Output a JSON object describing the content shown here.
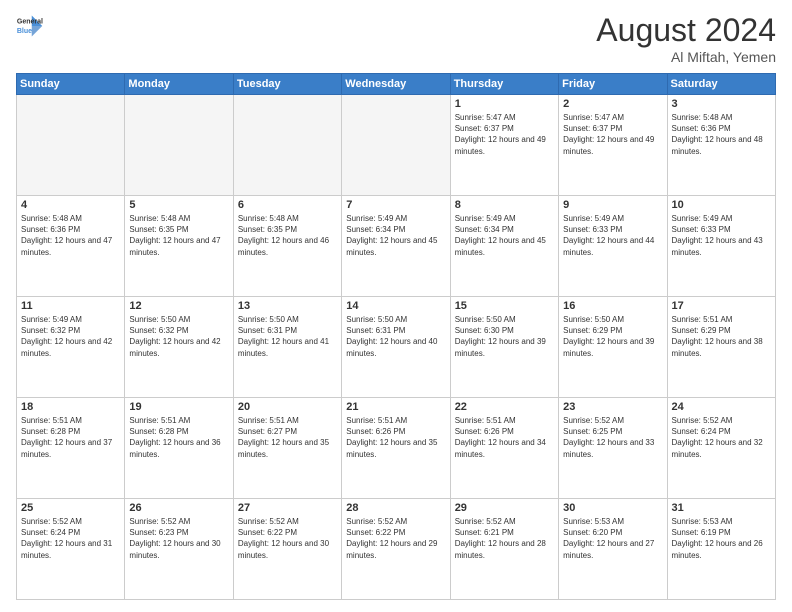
{
  "header": {
    "logo_line1": "General",
    "logo_line2": "Blue",
    "month_year": "August 2024",
    "location": "Al Miftah, Yemen"
  },
  "days_of_week": [
    "Sunday",
    "Monday",
    "Tuesday",
    "Wednesday",
    "Thursday",
    "Friday",
    "Saturday"
  ],
  "weeks": [
    [
      {
        "day": "",
        "empty": true
      },
      {
        "day": "",
        "empty": true
      },
      {
        "day": "",
        "empty": true
      },
      {
        "day": "",
        "empty": true
      },
      {
        "day": "1",
        "sunrise": "5:47 AM",
        "sunset": "6:37 PM",
        "daylight": "12 hours and 49 minutes."
      },
      {
        "day": "2",
        "sunrise": "5:47 AM",
        "sunset": "6:37 PM",
        "daylight": "12 hours and 49 minutes."
      },
      {
        "day": "3",
        "sunrise": "5:48 AM",
        "sunset": "6:36 PM",
        "daylight": "12 hours and 48 minutes."
      }
    ],
    [
      {
        "day": "4",
        "sunrise": "5:48 AM",
        "sunset": "6:36 PM",
        "daylight": "12 hours and 47 minutes."
      },
      {
        "day": "5",
        "sunrise": "5:48 AM",
        "sunset": "6:35 PM",
        "daylight": "12 hours and 47 minutes."
      },
      {
        "day": "6",
        "sunrise": "5:48 AM",
        "sunset": "6:35 PM",
        "daylight": "12 hours and 46 minutes."
      },
      {
        "day": "7",
        "sunrise": "5:49 AM",
        "sunset": "6:34 PM",
        "daylight": "12 hours and 45 minutes."
      },
      {
        "day": "8",
        "sunrise": "5:49 AM",
        "sunset": "6:34 PM",
        "daylight": "12 hours and 45 minutes."
      },
      {
        "day": "9",
        "sunrise": "5:49 AM",
        "sunset": "6:33 PM",
        "daylight": "12 hours and 44 minutes."
      },
      {
        "day": "10",
        "sunrise": "5:49 AM",
        "sunset": "6:33 PM",
        "daylight": "12 hours and 43 minutes."
      }
    ],
    [
      {
        "day": "11",
        "sunrise": "5:49 AM",
        "sunset": "6:32 PM",
        "daylight": "12 hours and 42 minutes."
      },
      {
        "day": "12",
        "sunrise": "5:50 AM",
        "sunset": "6:32 PM",
        "daylight": "12 hours and 42 minutes."
      },
      {
        "day": "13",
        "sunrise": "5:50 AM",
        "sunset": "6:31 PM",
        "daylight": "12 hours and 41 minutes."
      },
      {
        "day": "14",
        "sunrise": "5:50 AM",
        "sunset": "6:31 PM",
        "daylight": "12 hours and 40 minutes."
      },
      {
        "day": "15",
        "sunrise": "5:50 AM",
        "sunset": "6:30 PM",
        "daylight": "12 hours and 39 minutes."
      },
      {
        "day": "16",
        "sunrise": "5:50 AM",
        "sunset": "6:29 PM",
        "daylight": "12 hours and 39 minutes."
      },
      {
        "day": "17",
        "sunrise": "5:51 AM",
        "sunset": "6:29 PM",
        "daylight": "12 hours and 38 minutes."
      }
    ],
    [
      {
        "day": "18",
        "sunrise": "5:51 AM",
        "sunset": "6:28 PM",
        "daylight": "12 hours and 37 minutes."
      },
      {
        "day": "19",
        "sunrise": "5:51 AM",
        "sunset": "6:28 PM",
        "daylight": "12 hours and 36 minutes."
      },
      {
        "day": "20",
        "sunrise": "5:51 AM",
        "sunset": "6:27 PM",
        "daylight": "12 hours and 35 minutes."
      },
      {
        "day": "21",
        "sunrise": "5:51 AM",
        "sunset": "6:26 PM",
        "daylight": "12 hours and 35 minutes."
      },
      {
        "day": "22",
        "sunrise": "5:51 AM",
        "sunset": "6:26 PM",
        "daylight": "12 hours and 34 minutes."
      },
      {
        "day": "23",
        "sunrise": "5:52 AM",
        "sunset": "6:25 PM",
        "daylight": "12 hours and 33 minutes."
      },
      {
        "day": "24",
        "sunrise": "5:52 AM",
        "sunset": "6:24 PM",
        "daylight": "12 hours and 32 minutes."
      }
    ],
    [
      {
        "day": "25",
        "sunrise": "5:52 AM",
        "sunset": "6:24 PM",
        "daylight": "12 hours and 31 minutes."
      },
      {
        "day": "26",
        "sunrise": "5:52 AM",
        "sunset": "6:23 PM",
        "daylight": "12 hours and 30 minutes."
      },
      {
        "day": "27",
        "sunrise": "5:52 AM",
        "sunset": "6:22 PM",
        "daylight": "12 hours and 30 minutes."
      },
      {
        "day": "28",
        "sunrise": "5:52 AM",
        "sunset": "6:22 PM",
        "daylight": "12 hours and 29 minutes."
      },
      {
        "day": "29",
        "sunrise": "5:52 AM",
        "sunset": "6:21 PM",
        "daylight": "12 hours and 28 minutes."
      },
      {
        "day": "30",
        "sunrise": "5:53 AM",
        "sunset": "6:20 PM",
        "daylight": "12 hours and 27 minutes."
      },
      {
        "day": "31",
        "sunrise": "5:53 AM",
        "sunset": "6:19 PM",
        "daylight": "12 hours and 26 minutes."
      }
    ]
  ]
}
